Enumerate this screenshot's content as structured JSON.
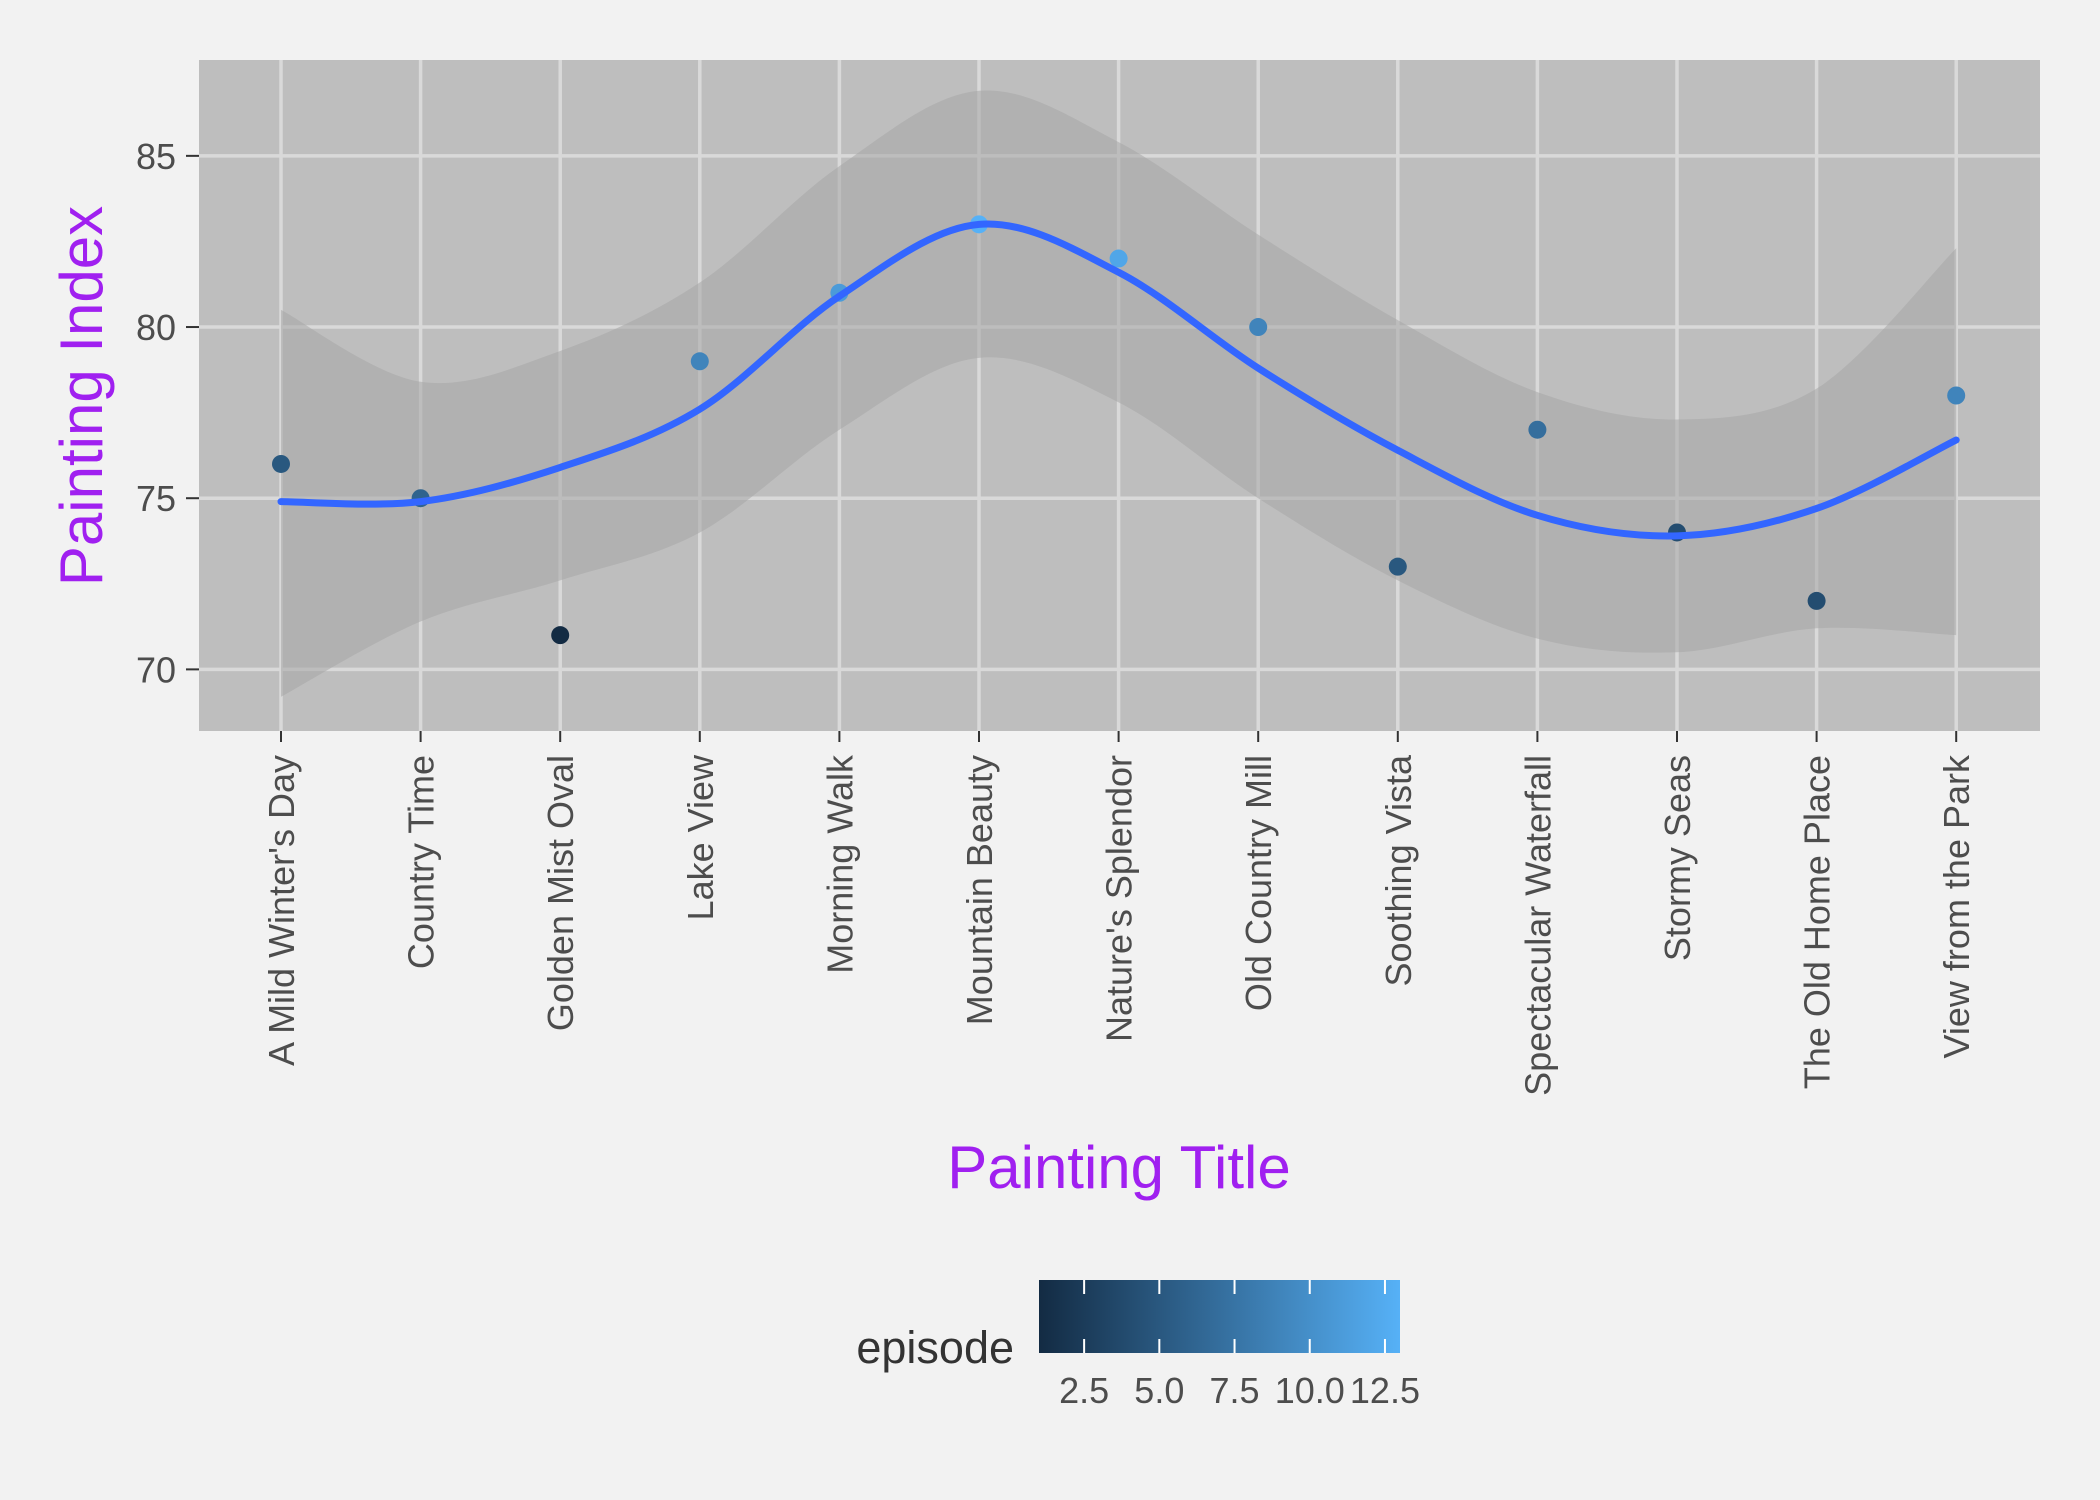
{
  "chart_data": {
    "type": "scatter",
    "title": "",
    "xlabel": "Painting Title",
    "ylabel": "Painting Index",
    "categories": [
      "A Mild Winter's Day",
      "Country Time",
      "Golden Mist Oval",
      "Lake View",
      "Morning Walk",
      "Mountain Beauty",
      "Nature's Splendor",
      "Old Country Mill",
      "Soothing Vista",
      "Spectacular Waterfall",
      "Stormy Seas",
      "The Old Home Place",
      "View from the Park"
    ],
    "values": [
      76,
      75,
      71,
      79,
      81,
      83,
      82,
      80,
      73,
      77,
      74,
      72,
      78
    ],
    "episode": [
      5,
      6,
      1,
      9,
      11,
      13,
      12,
      9,
      5,
      7,
      4,
      4,
      9
    ],
    "ylim": [
      68.2,
      87.8
    ],
    "yticks": [
      70,
      75,
      80,
      85
    ],
    "smooth": {
      "values": [
        74.9,
        74.9,
        75.9,
        77.6,
        80.9,
        83.0,
        81.6,
        78.8,
        76.4,
        74.5,
        73.9,
        74.7,
        76.7
      ],
      "upper": [
        80.5,
        78.4,
        79.3,
        81.3,
        84.7,
        86.9,
        85.4,
        82.7,
        80.2,
        78.1,
        77.3,
        78.2,
        82.3
      ],
      "lower": [
        69.2,
        71.4,
        72.6,
        74.0,
        77.0,
        79.1,
        77.8,
        75.0,
        72.6,
        70.9,
        70.5,
        71.2,
        71.0
      ]
    },
    "legend": {
      "title": "episode",
      "placement": "bottom",
      "ticks": [
        "2.5",
        "5.0",
        "7.5",
        "10.0",
        "12.5"
      ],
      "tick_values": [
        2.5,
        5.0,
        7.5,
        10.0,
        12.5
      ],
      "min": 1,
      "max": 13
    },
    "grid": true,
    "colors": {
      "panel": "#bebebe",
      "grid": "#d9d9d9",
      "ribbon": "#a6a6a6",
      "line": "#3366ff",
      "axis_title": "#a020f0",
      "tick_text": "#4d4d4d",
      "legend_text": "#333333",
      "gradient_low": "#132b43",
      "gradient_high": "#56b1f7"
    }
  }
}
